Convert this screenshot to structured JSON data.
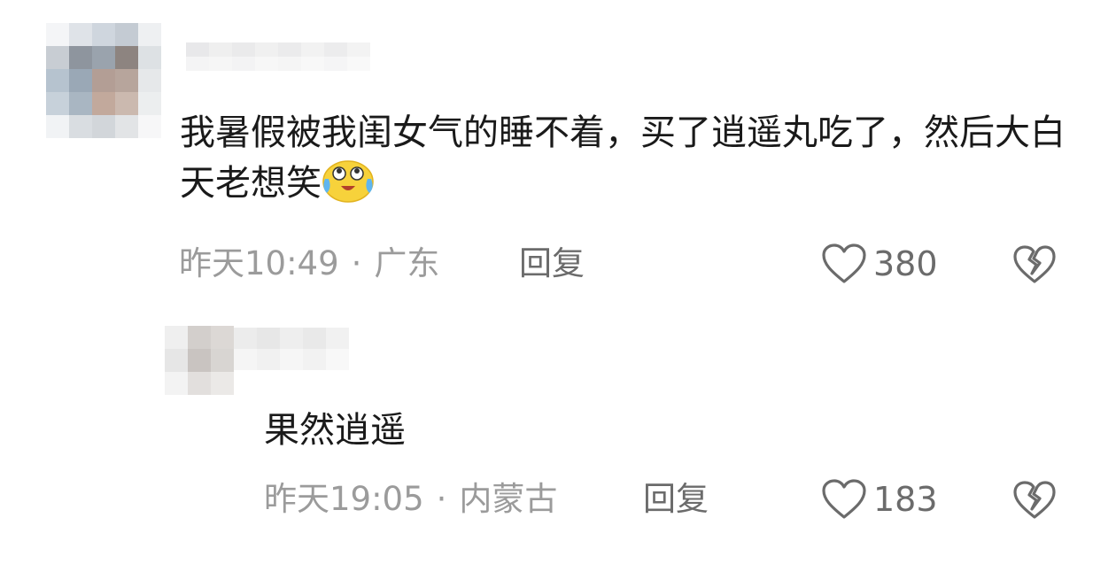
{
  "comments": [
    {
      "text": "我暑假被我闺女气的睡不着，买了逍遥丸吃了，然后大白天老想笑",
      "emoji": "crying-laughing-emoji",
      "time": "昨天10:49",
      "separator": "·",
      "location": "广东",
      "reply_label": "回复",
      "likes": "380",
      "like_icon": "heart-outline-icon",
      "dislike_icon": "broken-heart-icon"
    },
    {
      "text": "果然逍遥",
      "time": "昨天19:05",
      "separator": "·",
      "location": "内蒙古",
      "reply_label": "回复",
      "likes": "183",
      "like_icon": "heart-outline-icon",
      "dislike_icon": "broken-heart-icon"
    }
  ],
  "colors": {
    "text": "#1a1a1a",
    "meta": "#9b9b9b",
    "action": "#6b6b6b",
    "emoji_face": "#f7d23b"
  }
}
